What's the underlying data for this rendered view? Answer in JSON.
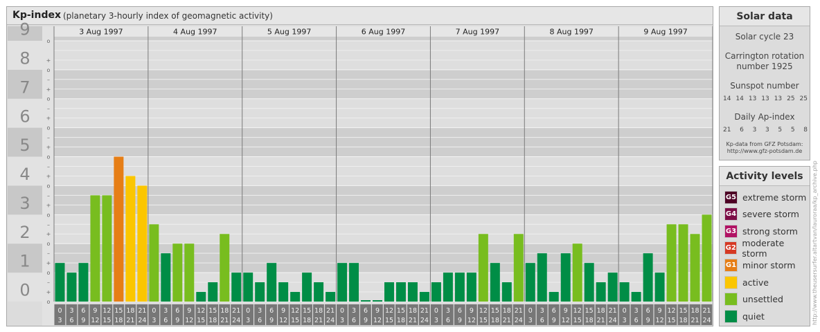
{
  "header": {
    "title": "Kp-index",
    "subtitle": "(planetary 3-hourly index of geomagnetic activity)"
  },
  "chart_data": {
    "type": "bar",
    "y_levels": [
      "0",
      "1",
      "2",
      "3",
      "4",
      "5",
      "6",
      "7",
      "8",
      "9"
    ],
    "thirds": [
      "+",
      "o",
      "–"
    ],
    "ylim": [
      0,
      9
    ],
    "days": [
      "3 Aug 1997",
      "4 Aug 1997",
      "5 Aug 1997",
      "6 Aug 1997",
      "7 Aug 1997",
      "8 Aug 1997",
      "9 Aug 1997"
    ],
    "interval_starts": [
      "0",
      "3",
      "6",
      "9",
      "12",
      "15",
      "18",
      "21"
    ],
    "interval_ends": [
      "3",
      "6",
      "9",
      "12",
      "15",
      "18",
      "21",
      "24"
    ],
    "values": [
      [
        1.333,
        1.0,
        1.333,
        3.667,
        3.667,
        5.0,
        4.333,
        4.0
      ],
      [
        2.667,
        1.667,
        2.0,
        2.0,
        0.333,
        0.667,
        2.333,
        1.0
      ],
      [
        1.0,
        0.667,
        1.333,
        0.667,
        0.333,
        1.0,
        0.667,
        0.333
      ],
      [
        1.333,
        1.333,
        0.0,
        0.0,
        0.667,
        0.667,
        0.667,
        0.333
      ],
      [
        0.667,
        1.0,
        1.0,
        1.0,
        2.333,
        1.333,
        0.667,
        2.333
      ],
      [
        1.333,
        1.667,
        0.333,
        1.667,
        2.0,
        1.333,
        0.667,
        1.0
      ],
      [
        0.667,
        0.333,
        1.667,
        1.0,
        2.667,
        2.667,
        2.333,
        3.0
      ]
    ],
    "bar_colors": {
      "quiet": "#008d46",
      "unsettled": "#78bd1f",
      "active": "#fbc600",
      "minor": "#e67e16"
    }
  },
  "solar": {
    "title": "Solar data",
    "cycle": "Solar cycle 23",
    "carrington_1": "Carrington rotation",
    "carrington_2": "number 1925",
    "sunspot_title": "Sunspot number",
    "sunspot_values": [
      "14",
      "14",
      "13",
      "13",
      "13",
      "25",
      "25"
    ],
    "ap_title": "Daily Ap-index",
    "ap_values": [
      "21",
      "6",
      "3",
      "3",
      "5",
      "5",
      "8"
    ],
    "source_1": "Kp-data from GFZ Potsdam:",
    "source_2": "http://www.gfz-potsdam.de"
  },
  "activity": {
    "title": "Activity levels",
    "levels": [
      {
        "code": "G5",
        "label": "extreme storm",
        "color": "#4e0025"
      },
      {
        "code": "G4",
        "label": "severe storm",
        "color": "#7c0d46"
      },
      {
        "code": "G3",
        "label": "strong storm",
        "color": "#b11364"
      },
      {
        "code": "G2",
        "label": "moderate storm",
        "color": "#d63924"
      },
      {
        "code": "G1",
        "label": "minor storm",
        "color": "#e67e16"
      },
      {
        "code": "",
        "label": "active",
        "color": "#fbc600"
      },
      {
        "code": "",
        "label": "unsettled",
        "color": "#78bd1f"
      },
      {
        "code": "",
        "label": "quiet",
        "color": "#008d46"
      }
    ]
  },
  "watermark": "http://www.theusersurfer.altartvan/lauroraa/kp_archive.php"
}
